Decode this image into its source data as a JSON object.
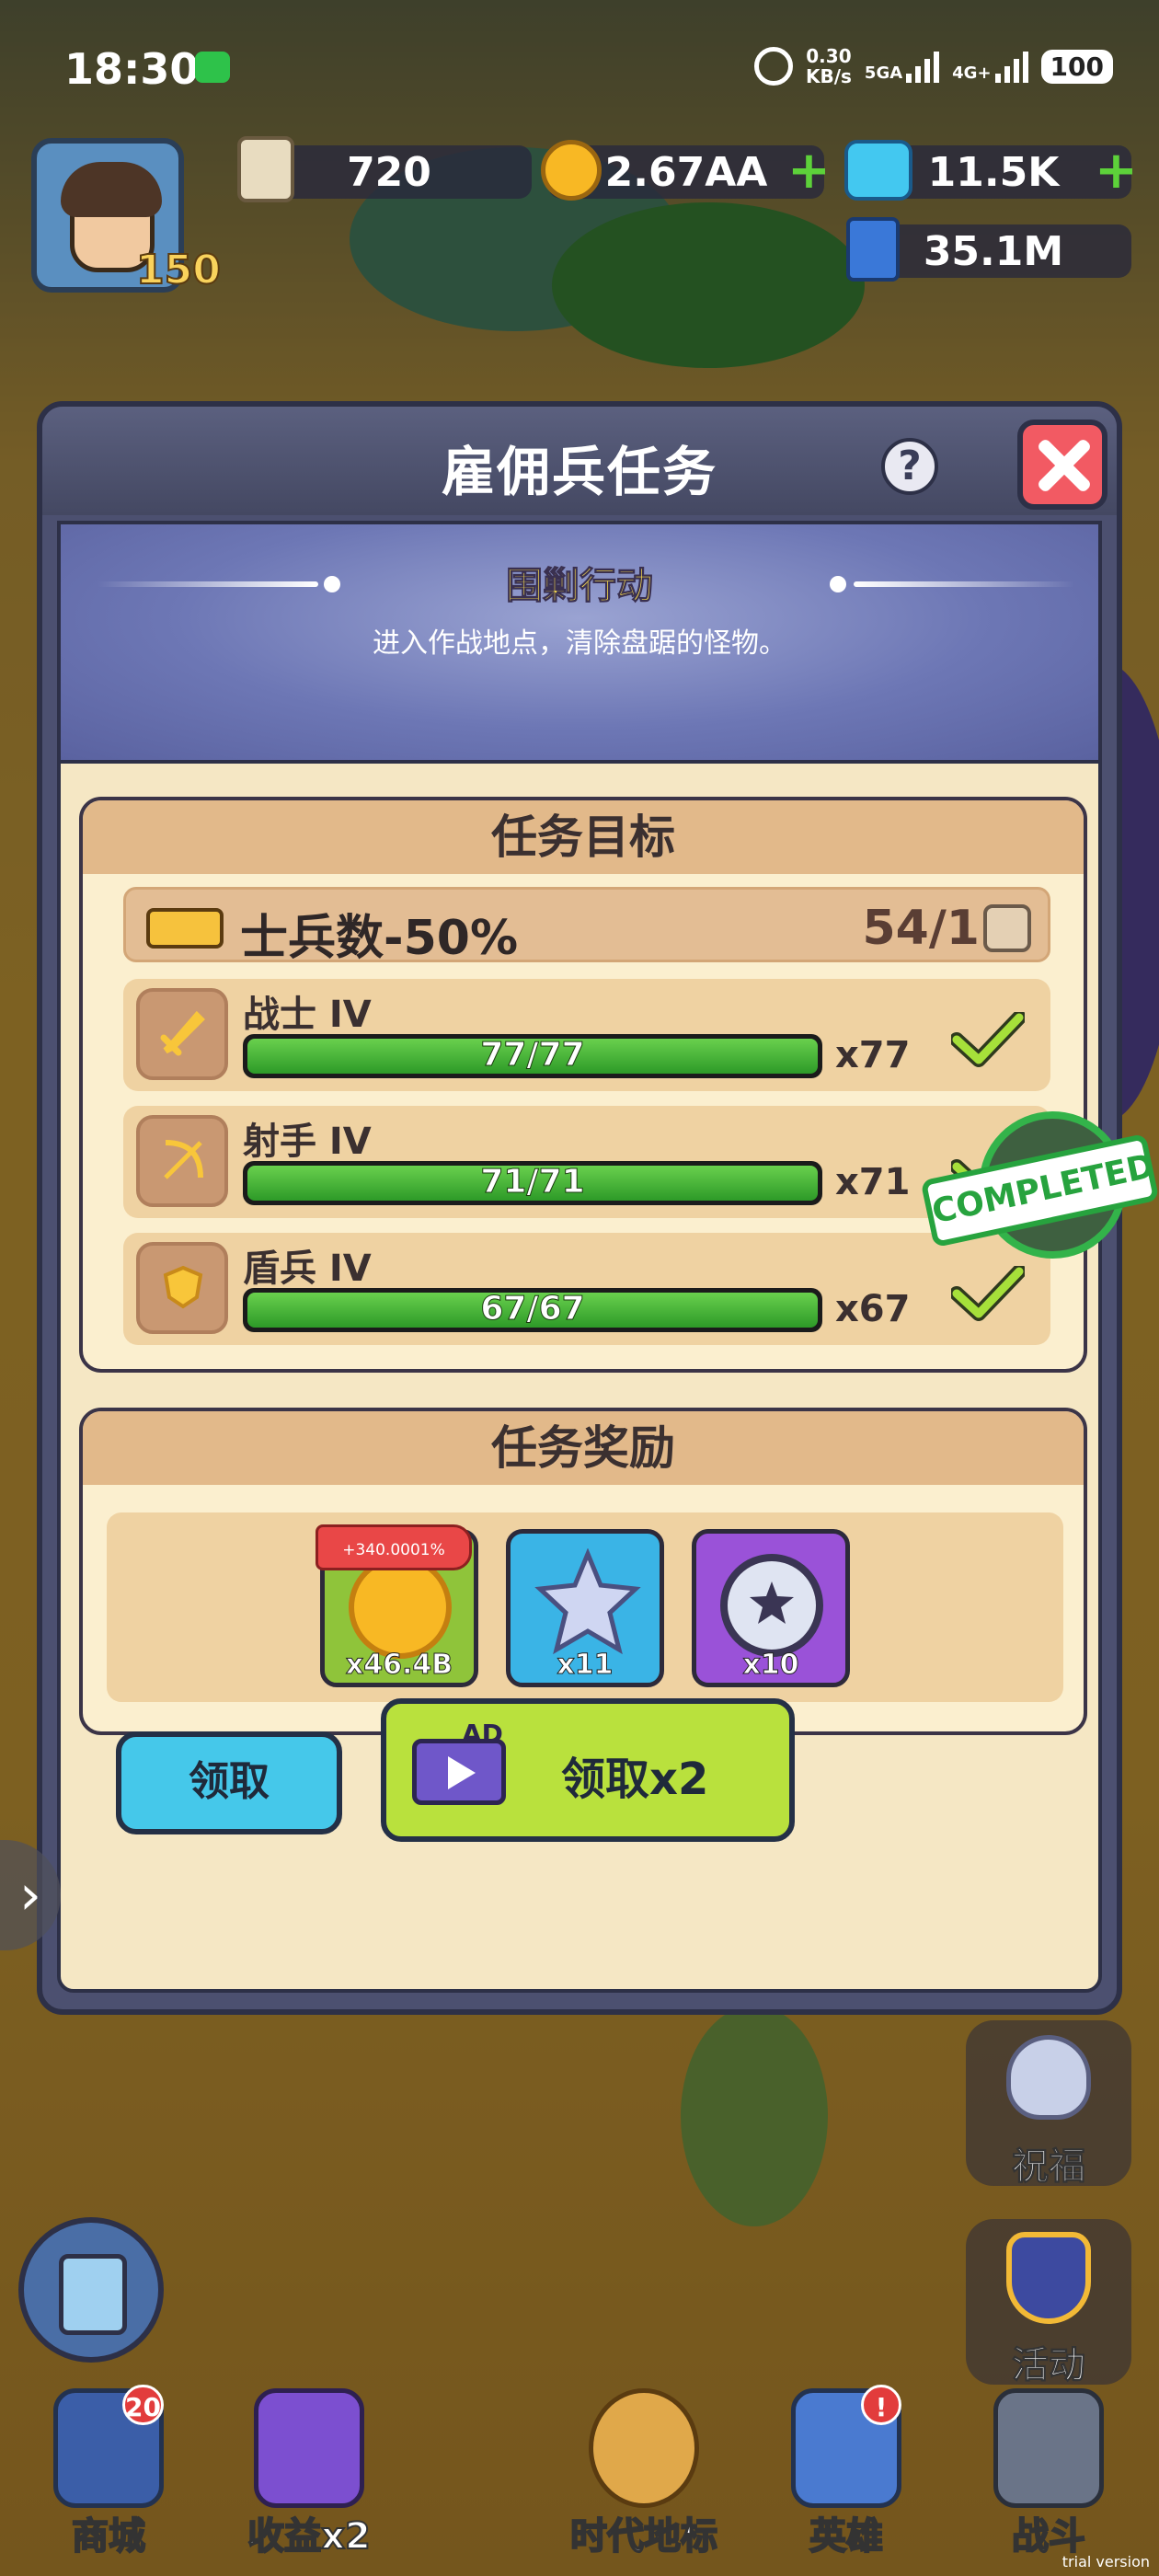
{
  "status_bar": {
    "time": "18:30",
    "net_speed_value": "0.30",
    "net_speed_unit": "KB/s",
    "sig1": "5GA",
    "sig2": "4G+",
    "battery": "100"
  },
  "hud": {
    "level": "150",
    "marble": "720",
    "gold": "2.67AA",
    "gems": "11.5K",
    "exp": "35.1M"
  },
  "dialog": {
    "title": "雇佣兵任务",
    "quest_name": "围剿行动",
    "quest_desc": "进入作战地点，清除盘踞的怪物。",
    "stamp": "COMPLETED",
    "objectives_title": "任务目标",
    "requirement": {
      "label": "士兵数-50%",
      "count": "54/1"
    },
    "units": [
      {
        "name": "战士 IV",
        "progress_text": "77/77",
        "progress": 1.0,
        "mult": "x77"
      },
      {
        "name": "射手 IV",
        "progress_text": "71/71",
        "progress": 1.0,
        "mult": "x71"
      },
      {
        "name": "盾兵 IV",
        "progress_text": "67/67",
        "progress": 1.0,
        "mult": "x67"
      }
    ],
    "rewards_title": "任务奖励",
    "rewards": [
      {
        "amount": "x46.4B",
        "tag": "+340.0001%",
        "icon": "gold-coin-icon"
      },
      {
        "amount": "x11",
        "icon": "crystal-star-icon"
      },
      {
        "amount": "x10",
        "icon": "star-medal-icon"
      }
    ],
    "claim_label": "领取",
    "claim_x2_label": "领取x2",
    "ad_label": "AD"
  },
  "side_buttons": {
    "bless": "祝福",
    "event": "活动"
  },
  "nav": [
    {
      "label": "商城",
      "badge": "20"
    },
    {
      "label": "收益x2"
    },
    {
      "label": "时代地标"
    },
    {
      "label": "英雄",
      "badge": "!"
    },
    {
      "label": "战斗"
    }
  ],
  "watermark": "trial version",
  "colors": {
    "progress_green": "#3db332",
    "stamp_green": "#27a33e",
    "claim_blue": "#45c8ea",
    "claim_x2_lime": "#b9e13d"
  }
}
